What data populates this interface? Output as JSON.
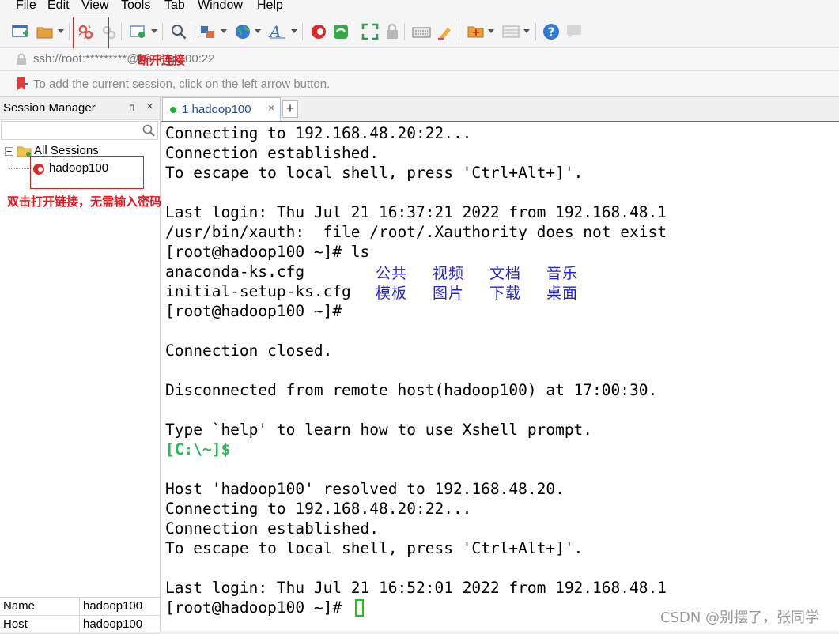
{
  "menu": [
    "File",
    "Edit",
    "View",
    "Tools",
    "Tab",
    "Window",
    "Help"
  ],
  "address": {
    "text": "ssh://root:*********@hadoop100:22"
  },
  "info": {
    "text": "To add the current session, click on the left arrow button."
  },
  "annotations": {
    "disconnect": "断开连接",
    "double_click": "双击打开链接，无需输入密码"
  },
  "session_manager": {
    "title": "Session Manager",
    "pin": "ᴨ",
    "close": "×",
    "root": "All Sessions",
    "child": "hadoop100"
  },
  "properties": [
    {
      "key": "Name",
      "value": "hadoop100"
    },
    {
      "key": "Host",
      "value": "hadoop100"
    }
  ],
  "tab": {
    "label": "1 hadoop100",
    "close": "×",
    "add": "+"
  },
  "terminal": {
    "l1": "Connecting to 192.168.48.20:22...",
    "l2": "Connection established.",
    "l3": "To escape to local shell, press 'Ctrl+Alt+]'.",
    "l5": "Last login: Thu Jul 21 16:37:21 2022 from 192.168.48.1",
    "l6": "/usr/bin/xauth:  file /root/.Xauthority does not exist",
    "l7": "[root@hadoop100 ~]# ls",
    "l8": "anaconda-ks.cfg",
    "l9": "initial-setup-ks.cfg",
    "dirs1": [
      "公共",
      "视频",
      "文档",
      "音乐"
    ],
    "dirs2": [
      "模板",
      "图片",
      "下载",
      "桌面"
    ],
    "l10": "[root@hadoop100 ~]#",
    "l12": "Connection closed.",
    "l14": "Disconnected from remote host(hadoop100) at 17:00:30.",
    "l16": "Type `help' to learn how to use Xshell prompt.",
    "l17": "[C:\\~]$",
    "l19": "Host 'hadoop100' resolved to 192.168.48.20.",
    "l20": "Connecting to 192.168.48.20:22...",
    "l21": "Connection established.",
    "l22": "To escape to local shell, press 'Ctrl+Alt+]'.",
    "l24": "Last login: Thu Jul 21 16:52:01 2022 from 192.168.48.1",
    "l25": "[root@hadoop100 ~]#"
  },
  "watermark": "CSDN @别摆了，张同学",
  "colors": {
    "annotation": "#e8141c",
    "dir_blue": "#2222dd",
    "prompt_green": "#1fbf56",
    "cursor_green": "#19c819"
  }
}
